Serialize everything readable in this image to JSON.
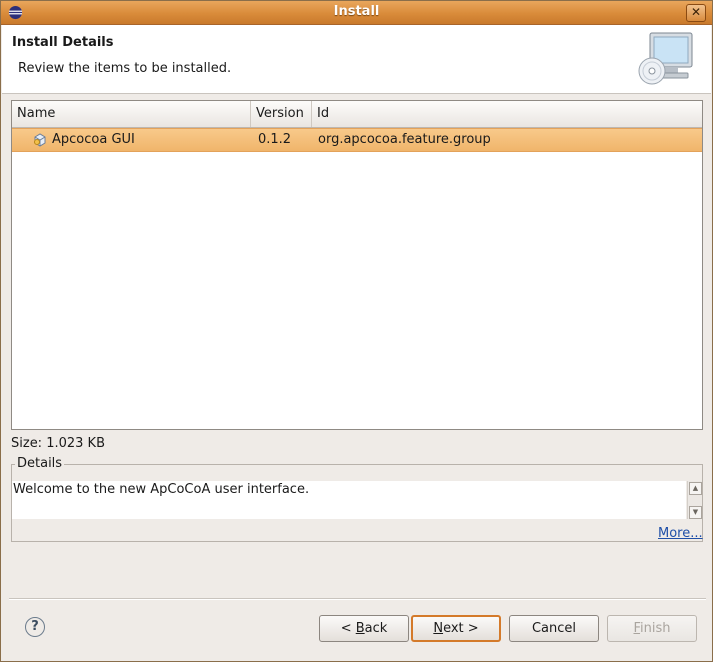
{
  "window": {
    "title": "Install"
  },
  "header": {
    "title": "Install Details",
    "subtitle": "Review the items to be installed."
  },
  "table": {
    "columns": [
      "Name",
      "Version",
      "Id"
    ],
    "rows": [
      {
        "name": "Apcocoa GUI",
        "version": "0.1.2",
        "id": "org.apcocoa.feature.group"
      }
    ]
  },
  "size_label": "Size: 1.023 KB",
  "details": {
    "legend": "Details",
    "text": "Welcome to the new ApCoCoA user interface.",
    "more_link": "More..."
  },
  "buttons": {
    "help": "?",
    "back": {
      "prefix": "< ",
      "mnemonic": "B",
      "rest": "ack"
    },
    "next": {
      "mnemonic": "N",
      "rest": "ext >"
    },
    "cancel": "Cancel",
    "finish": {
      "mnemonic": "F",
      "rest": "inish"
    }
  },
  "colors": {
    "titlebar": "#d98b3a",
    "selection": "#f0b56b",
    "link": "#1f4fa8"
  }
}
